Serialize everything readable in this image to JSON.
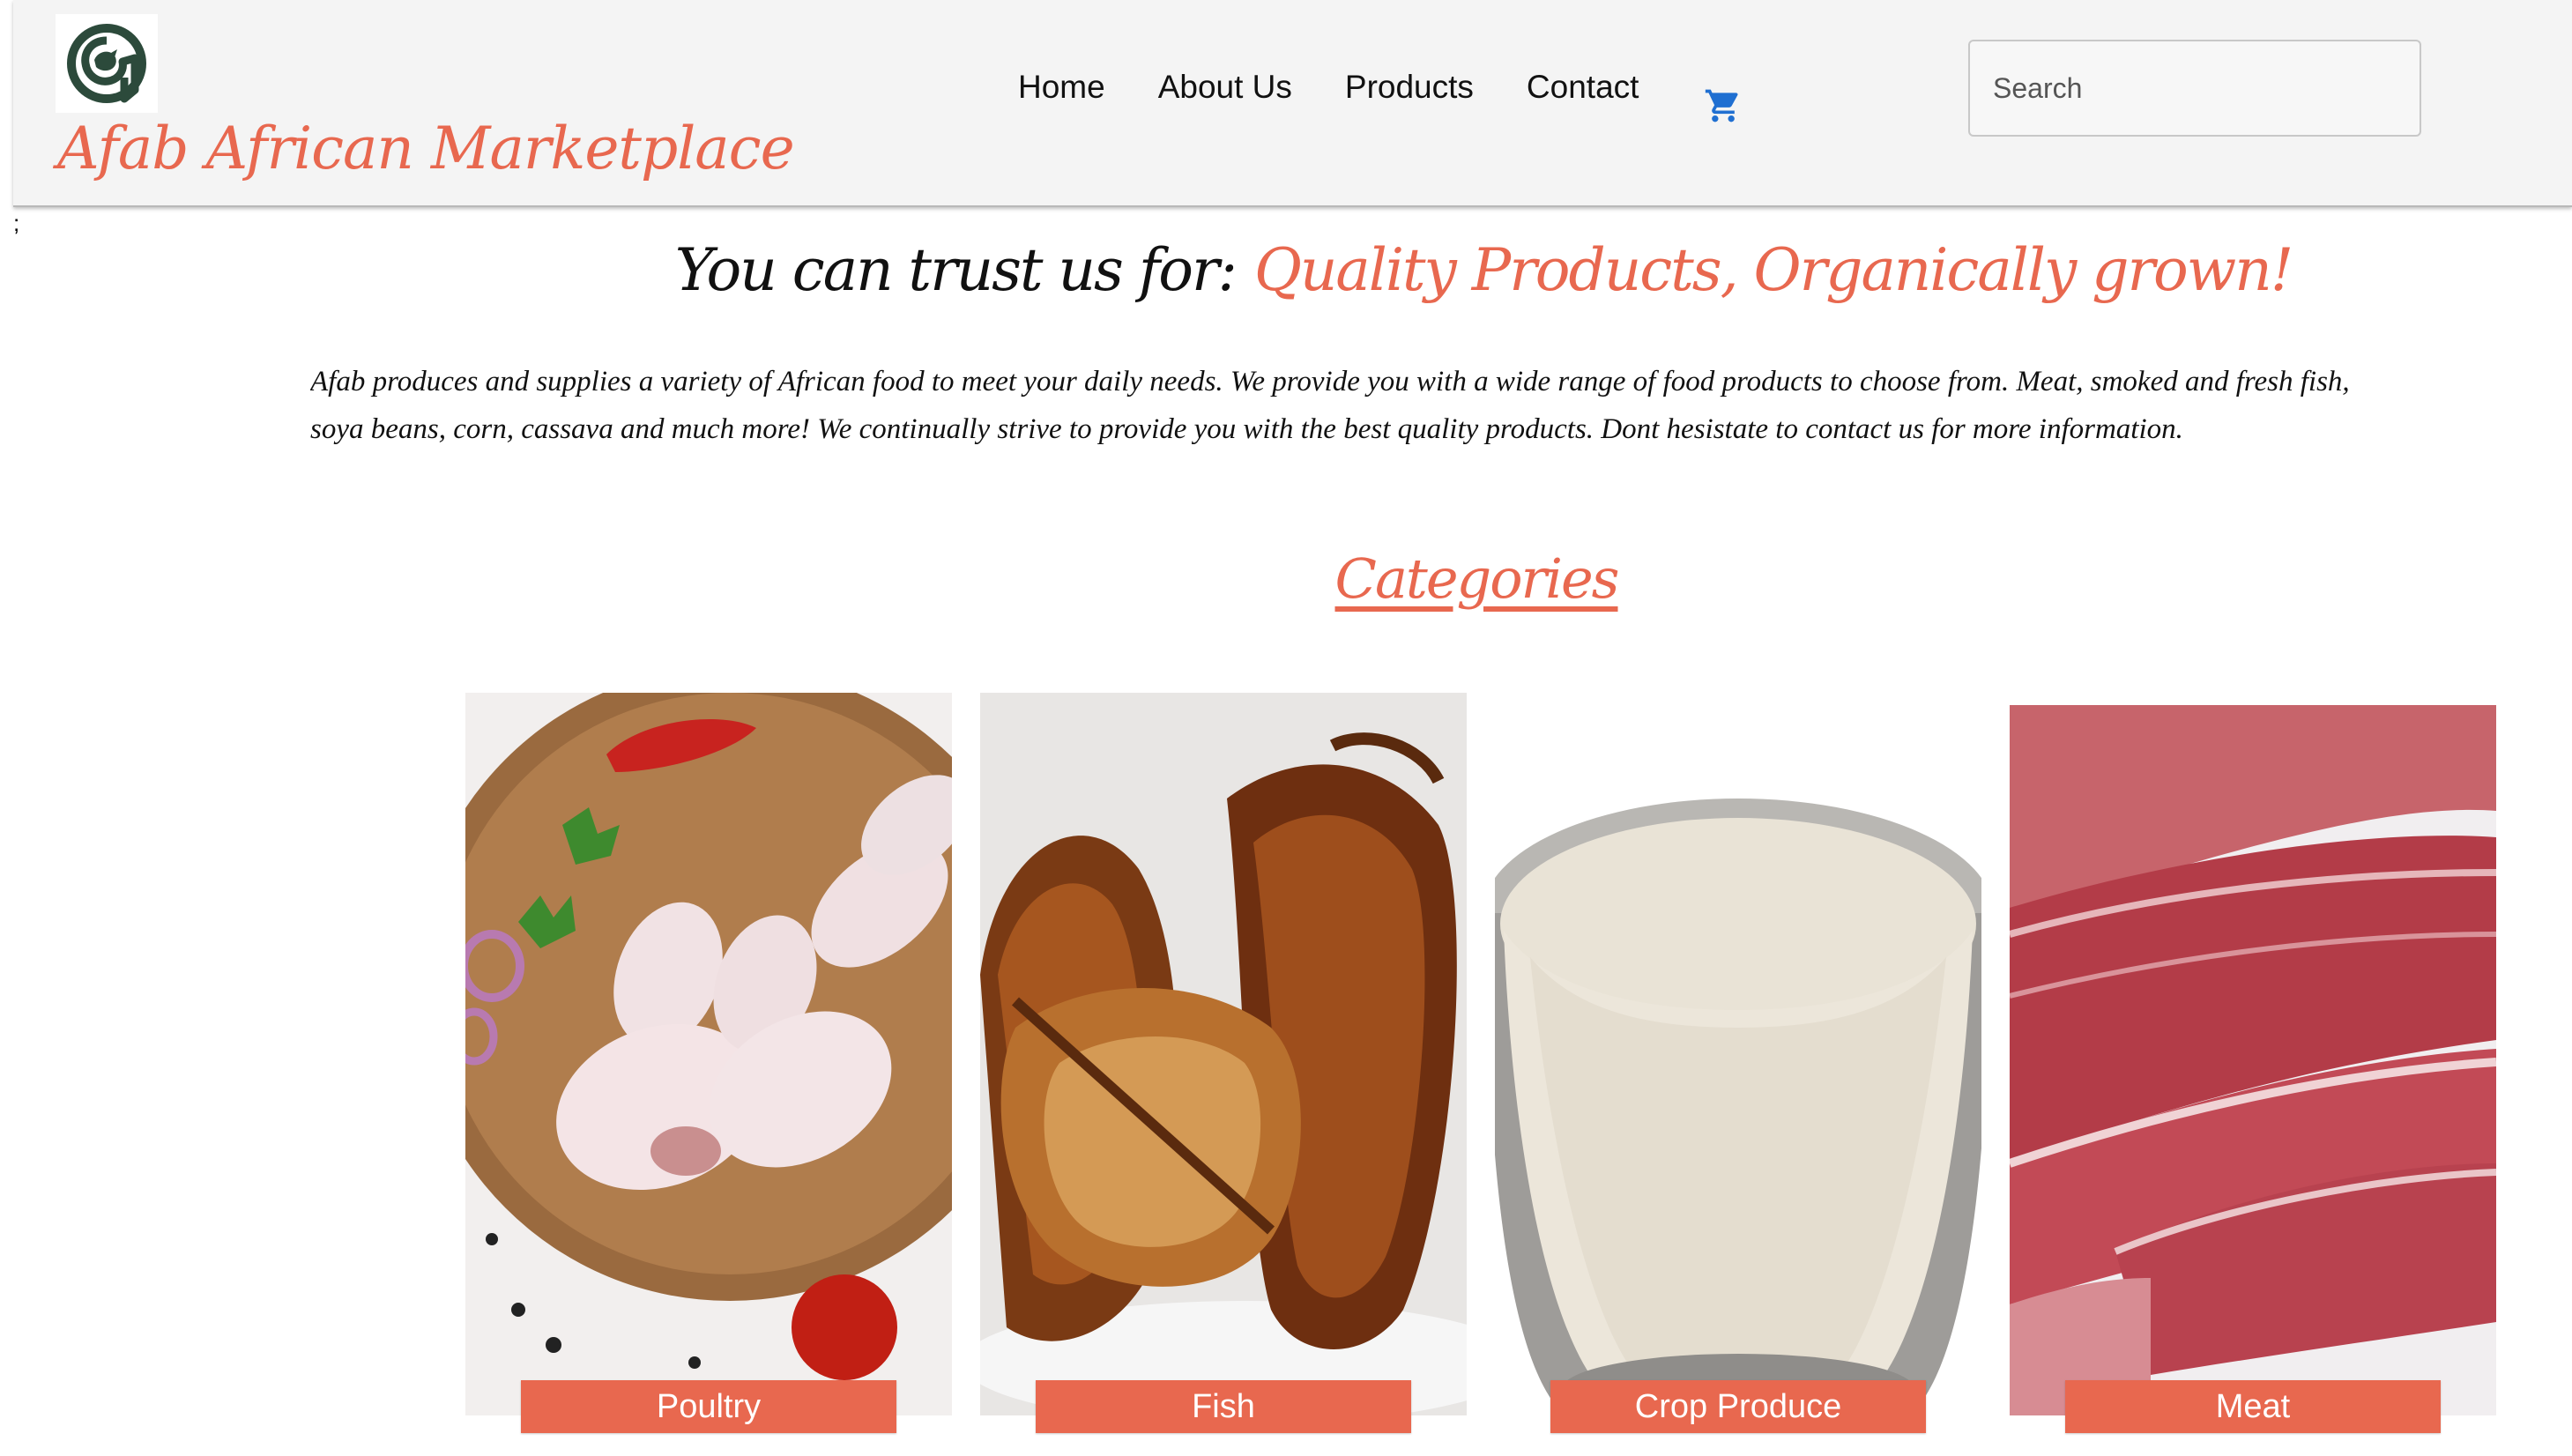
{
  "header": {
    "brand": "Afab African Marketplace",
    "logo": "afab-circle-logo",
    "nav": [
      "Home",
      "About Us",
      "Products",
      "Contact"
    ],
    "cart_icon": "shopping-cart-icon",
    "search": {
      "placeholder": "Search",
      "value": ""
    }
  },
  "stray_text": ";",
  "hero": {
    "tagline_lead": "You can trust us for:",
    "tagline_accent": "Quality Products, Organically grown!",
    "intro_line1": "Afab produces and supplies a variety of African food to meet your daily needs. We provide you with a wide range of food products to choose from. Meat, smoked and fresh fish,",
    "intro_line2": "soya beans, corn, cassava and much more! We continually strive to provide you with the best quality products. Dont hesistate to contact us for more information."
  },
  "categories": {
    "heading": "Categories",
    "items": [
      {
        "label": "Poultry",
        "image": "raw-chicken-drumsticks-photo"
      },
      {
        "label": "Fish",
        "image": "smoked-fish-photo"
      },
      {
        "label": "Crop Produce",
        "image": "garri-flour-bowl-photo"
      },
      {
        "label": "Meat",
        "image": "raw-beef-slices-photo"
      }
    ]
  },
  "colors": {
    "accent": "#e8684f",
    "header_bg": "#f4f4f4",
    "cart": "#1f6fd1",
    "logo": "#2c4a3b"
  }
}
